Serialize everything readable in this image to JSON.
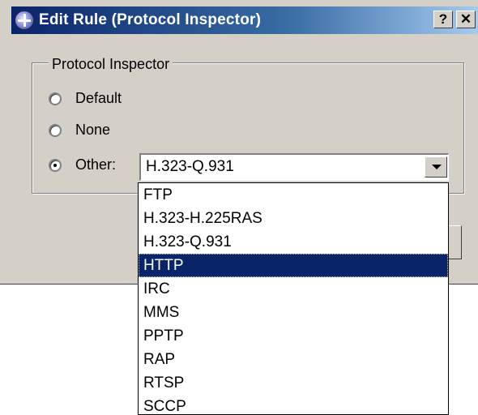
{
  "window": {
    "title": "Edit Rule (Protocol Inspector)",
    "help_label": "?",
    "close_label": "✕"
  },
  "group": {
    "label": "Protocol Inspector"
  },
  "options": {
    "default": "Default",
    "none": "None",
    "other": "Other:",
    "selected": "Other"
  },
  "combo": {
    "value": "H.323-Q.931"
  },
  "dropdown": {
    "items": [
      "FTP",
      "H.323-H.225RAS",
      "H.323-Q.931",
      "HTTP",
      "IRC",
      "MMS",
      "PPTP",
      "RAP",
      "RTSP",
      "SCCP"
    ],
    "highlighted": "HTTP"
  },
  "colors": {
    "title_bar": "#0a246a",
    "dialog_face": "#d4d0c8",
    "highlight": "#0a246a"
  }
}
